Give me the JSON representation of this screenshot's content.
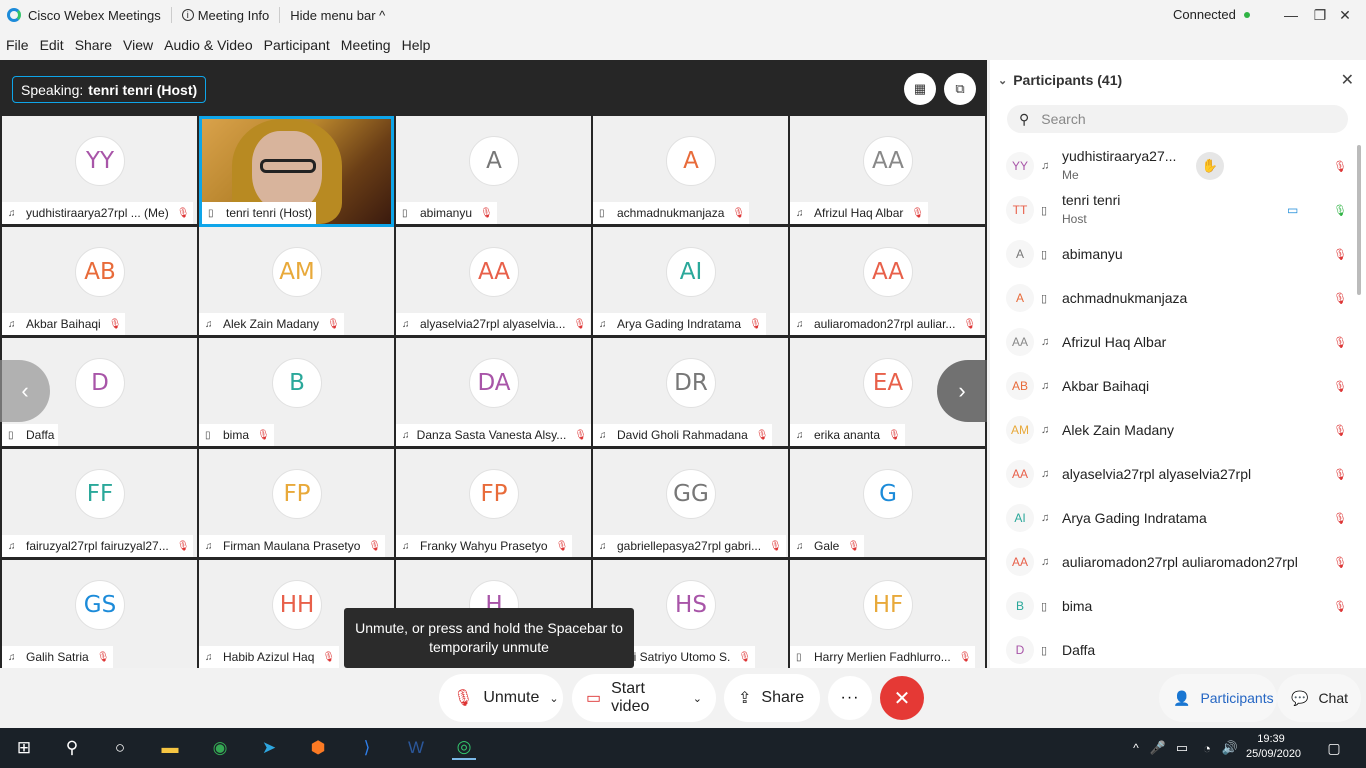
{
  "titlebar": {
    "app_name": "Cisco Webex Meetings",
    "meeting_info": "Meeting Info",
    "hide_menu": "Hide menu bar ^",
    "status": "Connected"
  },
  "menu": [
    "File",
    "Edit",
    "Share",
    "View",
    "Audio & Video",
    "Participant",
    "Meeting",
    "Help"
  ],
  "stage": {
    "speaking_label": "Speaking:",
    "speaking_name": "tenri tenri (Host)"
  },
  "tiles": [
    {
      "initials": "YY",
      "name": "yudhistiraarya27rpl ... (Me)",
      "color": "#a855a8",
      "device": "headset",
      "muted": true
    },
    {
      "initials": "",
      "name": "tenri tenri (Host)",
      "color": "#0ea5e9",
      "device": "phone",
      "muted": false,
      "video": true
    },
    {
      "initials": "A",
      "name": "abimanyu",
      "color": "#777777",
      "device": "phone",
      "muted": true
    },
    {
      "initials": "A",
      "name": "achmadnukmanjaza",
      "color": "#e86b3a",
      "device": "phone",
      "muted": true
    },
    {
      "initials": "AA",
      "name": "Afrizul Haq Albar",
      "color": "#888888",
      "device": "headset",
      "muted": true
    },
    {
      "initials": "AB",
      "name": "Akbar Baihaqi",
      "color": "#e86b3a",
      "device": "headset",
      "muted": true
    },
    {
      "initials": "AM",
      "name": "Alek Zain Madany",
      "color": "#e8a93a",
      "device": "headset",
      "muted": true
    },
    {
      "initials": "AA",
      "name": "alyaselvia27rpl alyaselvia...",
      "color": "#e8604a",
      "device": "headset",
      "muted": true
    },
    {
      "initials": "AI",
      "name": "Arya Gading Indratama",
      "color": "#2aa89a",
      "device": "headset",
      "muted": true
    },
    {
      "initials": "AA",
      "name": "auliaromadon27rpl auliar...",
      "color": "#e8604a",
      "device": "headset",
      "muted": true
    },
    {
      "initials": "D",
      "name": "Daffa",
      "color": "#a855a8",
      "device": "phone",
      "muted": false
    },
    {
      "initials": "B",
      "name": "bima",
      "color": "#2aa89a",
      "device": "phone",
      "muted": true
    },
    {
      "initials": "DA",
      "name": "Danza Sasta Vanesta Alsy...",
      "color": "#a855a8",
      "device": "headset",
      "muted": true
    },
    {
      "initials": "DR",
      "name": "David Gholi Rahmadana",
      "color": "#777777",
      "device": "headset",
      "muted": true
    },
    {
      "initials": "EA",
      "name": "erika ananta",
      "color": "#e8604a",
      "device": "headset",
      "muted": true
    },
    {
      "initials": "FF",
      "name": "fairuzyal27rpl fairuzyal27...",
      "color": "#2aa89a",
      "device": "headset",
      "muted": true
    },
    {
      "initials": "FP",
      "name": "Firman Maulana Prasetyo",
      "color": "#e8a93a",
      "device": "headset",
      "muted": true
    },
    {
      "initials": "FP",
      "name": "Franky Wahyu Prasetyo",
      "color": "#e86b3a",
      "device": "headset",
      "muted": true
    },
    {
      "initials": "GG",
      "name": "gabriellepasya27rpl gabri...",
      "color": "#777777",
      "device": "headset",
      "muted": true
    },
    {
      "initials": "G",
      "name": "Gale",
      "color": "#1c8bd9",
      "device": "headset",
      "muted": true
    },
    {
      "initials": "GS",
      "name": "Galih Satria",
      "color": "#1c8bd9",
      "device": "headset",
      "muted": true
    },
    {
      "initials": "HH",
      "name": "Habib Azizul Haq",
      "color": "#e8604a",
      "device": "headset",
      "muted": true
    },
    {
      "initials": "H",
      "name": "",
      "color": "#a855a8",
      "device": "",
      "muted": false
    },
    {
      "initials": "HS",
      "name": "nafi Satriyo Utomo S.",
      "color": "#a855a8",
      "device": "",
      "muted": true
    },
    {
      "initials": "HF",
      "name": "Harry Merlien Fadhlurro...",
      "color": "#e8a93a",
      "device": "phone",
      "muted": true
    }
  ],
  "tooltip": {
    "line1": "Unmute, or press and hold the Spacebar to",
    "line2": "temporarily unmute"
  },
  "controls": {
    "unmute": "Unmute",
    "start_video": "Start video",
    "share": "Share",
    "more": "···",
    "participants": "Participants",
    "chat": "Chat"
  },
  "panel": {
    "title": "Participants (41)",
    "search_placeholder": "Search",
    "participants": [
      {
        "initials": "YY",
        "name": "yudhistiraarya27...",
        "sub": "Me",
        "color": "#a855a8",
        "device": "headset",
        "muted": true
      },
      {
        "initials": "TT",
        "name": "tenri tenri",
        "sub": "Host",
        "color": "#e8604a",
        "device": "phone",
        "muted": false
      },
      {
        "initials": "A",
        "name": "abimanyu",
        "sub": "",
        "color": "#777777",
        "device": "phone",
        "muted": true
      },
      {
        "initials": "A",
        "name": "achmadnukmanjaza",
        "sub": "",
        "color": "#e86b3a",
        "device": "phone",
        "muted": true
      },
      {
        "initials": "AA",
        "name": "Afrizul Haq Albar",
        "sub": "",
        "color": "#888888",
        "device": "headset",
        "muted": true
      },
      {
        "initials": "AB",
        "name": "Akbar Baihaqi",
        "sub": "",
        "color": "#e86b3a",
        "device": "headset",
        "muted": true
      },
      {
        "initials": "AM",
        "name": "Alek Zain Madany",
        "sub": "",
        "color": "#e8a93a",
        "device": "headset",
        "muted": true
      },
      {
        "initials": "AA",
        "name": "alyaselvia27rpl alyaselvia27rpl",
        "sub": "",
        "color": "#e8604a",
        "device": "headset",
        "muted": true
      },
      {
        "initials": "AI",
        "name": "Arya Gading Indratama",
        "sub": "",
        "color": "#2aa89a",
        "device": "headset",
        "muted": true
      },
      {
        "initials": "AA",
        "name": "auliaromadon27rpl auliaromadon27rpl",
        "sub": "",
        "color": "#e8604a",
        "device": "headset",
        "muted": true
      },
      {
        "initials": "B",
        "name": "bima",
        "sub": "",
        "color": "#2aa89a",
        "device": "phone",
        "muted": true
      },
      {
        "initials": "D",
        "name": "Daffa",
        "sub": "",
        "color": "#a855a8",
        "device": "phone",
        "muted": false
      }
    ]
  },
  "taskbar": {
    "time": "19:39",
    "date": "25/09/2020"
  }
}
